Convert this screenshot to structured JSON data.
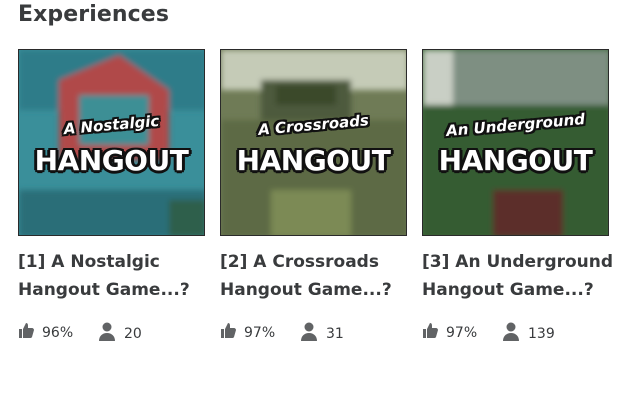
{
  "section": {
    "title": "Experiences"
  },
  "games": [
    {
      "thumb_sub": "A Nostalgic",
      "thumb_main": "HANGOUT",
      "title": "[1] A Nostalgic Hangout Game...?",
      "votes": "96%",
      "players": "20"
    },
    {
      "thumb_sub": "A Crossroads",
      "thumb_main": "HANGOUT",
      "title": "[2] A Crossroads Hangout Game...?",
      "votes": "97%",
      "players": "31"
    },
    {
      "thumb_sub": "An Underground",
      "thumb_main": "HANGOUT",
      "title": "[3] An Underground Hangout Game...?",
      "votes": "97%",
      "players": "139"
    }
  ],
  "icons": {
    "votes": "thumbs-up-icon",
    "players": "person-icon"
  },
  "colors": {
    "text": "#393b3d",
    "icon": "#616365"
  }
}
